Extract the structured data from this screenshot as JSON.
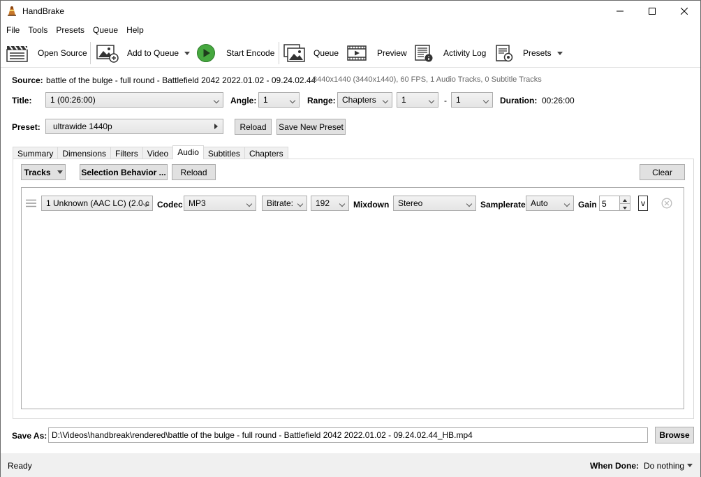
{
  "window": {
    "title": "HandBrake"
  },
  "menu": [
    "File",
    "Tools",
    "Presets",
    "Queue",
    "Help"
  ],
  "toolbar": {
    "open_source": "Open Source",
    "add_to_queue": "Add to Queue",
    "start_encode": "Start Encode",
    "queue": "Queue",
    "preview": "Preview",
    "activity_log": "Activity Log",
    "presets": "Presets"
  },
  "source": {
    "label": "Source:",
    "name": "battle of the bulge - full round - Battlefield 2042 2022.01.02 - 09.24.02.44",
    "info": "3440x1440 (3440x1440), 60 FPS, 1 Audio Tracks, 0 Subtitle Tracks"
  },
  "title_row": {
    "title_label": "Title:",
    "title_value": "1  (00:26:00)",
    "angle_label": "Angle:",
    "angle_value": "1",
    "range_label": "Range:",
    "range_value": "Chapters",
    "range_start": "1",
    "range_dash": "-",
    "range_end": "1",
    "duration_label": "Duration:",
    "duration_value": "00:26:00"
  },
  "preset_row": {
    "label": "Preset:",
    "value": "ultrawide 1440p",
    "reload": "Reload",
    "save_new": "Save New Preset"
  },
  "tabs": [
    "Summary",
    "Dimensions",
    "Filters",
    "Video",
    "Audio",
    "Subtitles",
    "Chapters"
  ],
  "audio": {
    "tracks": "Tracks",
    "selection_behavior": "Selection Behavior ...",
    "reload": "Reload",
    "clear": "Clear",
    "track": {
      "source": "1 Unknown (AAC LC) (2.0 c",
      "codec_label": "Codec",
      "codec": "MP3",
      "bitrate_mode": "Bitrate:",
      "bitrate": "192",
      "mixdown_label": "Mixdown",
      "mixdown": "Stereo",
      "samplerate_label": "Samplerate",
      "samplerate": "Auto",
      "gain_label": "Gain",
      "gain": "5",
      "extra": "v"
    }
  },
  "save_as": {
    "label": "Save As:",
    "path": "D:\\Videos\\handbreak\\rendered\\battle of the bulge - full round - Battlefield 2042 2022.01.02 - 09.24.02.44_HB.mp4",
    "browse": "Browse"
  },
  "status": {
    "text": "Ready",
    "when_done_label": "When Done:",
    "when_done_value": "Do nothing"
  },
  "colors": {
    "accent_green": "#3fa33f",
    "window_bg": "#f0f0f0"
  }
}
